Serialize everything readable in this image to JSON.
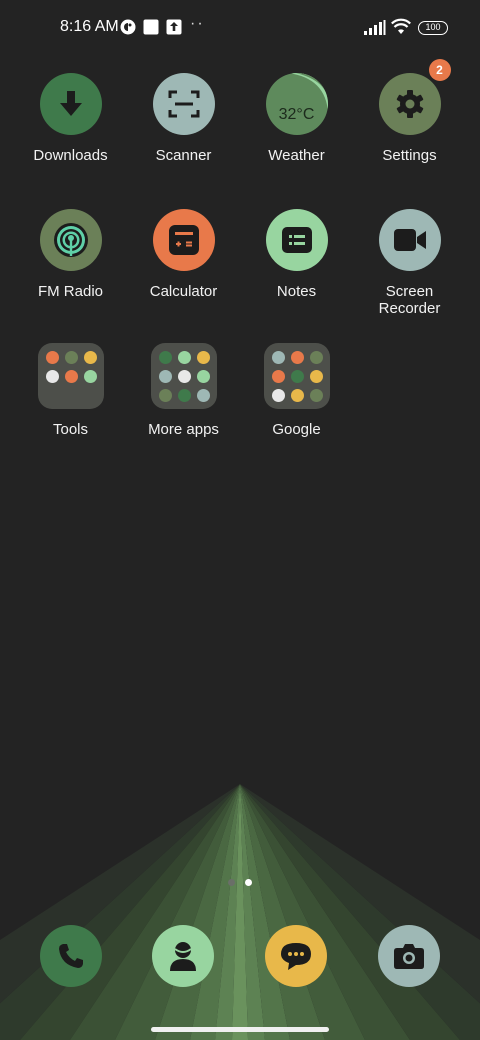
{
  "status_bar": {
    "time": "8:16 AM",
    "dots": "··",
    "battery": "100"
  },
  "apps": [
    {
      "label": "Downloads",
      "icon": "download-icon",
      "color": "#3f7a4b"
    },
    {
      "label": "Scanner",
      "icon": "scanner-icon",
      "color": "#9eb8b5"
    },
    {
      "label": "Weather",
      "icon": "weather-icon",
      "color": "#5e8a5c",
      "temp": "32°C"
    },
    {
      "label": "Settings",
      "icon": "gear-icon",
      "color": "#6b8058",
      "badge": "2"
    },
    {
      "label": "FM Radio",
      "icon": "radio-icon",
      "color": "#6b8058"
    },
    {
      "label": "Calculator",
      "icon": "calculator-icon",
      "color": "#e8794a"
    },
    {
      "label": "Notes",
      "icon": "notes-icon",
      "color": "#98d5a0"
    },
    {
      "label": "Screen Recorder",
      "icon": "video-camera-icon",
      "color": "#9eb8b5"
    }
  ],
  "folders": [
    {
      "label": "Tools"
    },
    {
      "label": "More apps"
    },
    {
      "label": "Google"
    }
  ],
  "dock": [
    {
      "name": "phone-icon",
      "color": "#3f7a4b"
    },
    {
      "name": "contacts-icon",
      "color": "#98d5a0"
    },
    {
      "name": "messages-icon",
      "color": "#e8b84a"
    },
    {
      "name": "camera-icon",
      "color": "#9eb8b5"
    }
  ],
  "page_indicator": {
    "pages": 2,
    "current": 2
  }
}
